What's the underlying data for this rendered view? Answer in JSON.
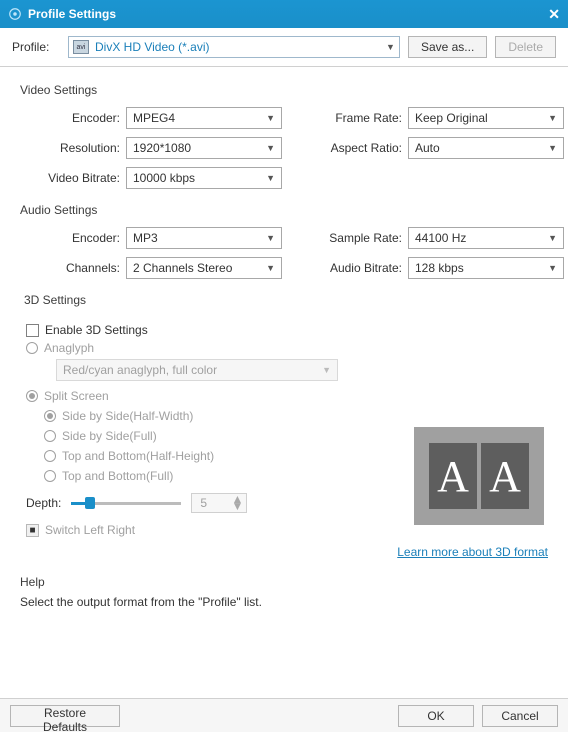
{
  "title": "Profile Settings",
  "profile": {
    "label": "Profile:",
    "iconText": "avi",
    "value": "DivX HD Video (*.avi)",
    "saveAs": "Save as...",
    "delete": "Delete"
  },
  "videoSettings": {
    "title": "Video Settings",
    "encoder": {
      "label": "Encoder:",
      "value": "MPEG4"
    },
    "resolution": {
      "label": "Resolution:",
      "value": "1920*1080"
    },
    "videoBitrate": {
      "label": "Video Bitrate:",
      "value": "10000 kbps"
    },
    "frameRate": {
      "label": "Frame Rate:",
      "value": "Keep Original"
    },
    "aspectRatio": {
      "label": "Aspect Ratio:",
      "value": "Auto"
    }
  },
  "audioSettings": {
    "title": "Audio Settings",
    "encoder": {
      "label": "Encoder:",
      "value": "MP3"
    },
    "channels": {
      "label": "Channels:",
      "value": "2 Channels Stereo"
    },
    "sampleRate": {
      "label": "Sample Rate:",
      "value": "44100 Hz"
    },
    "audioBitrate": {
      "label": "Audio Bitrate:",
      "value": "128 kbps"
    }
  },
  "threeD": {
    "title": "3D Settings",
    "enable": "Enable 3D Settings",
    "anaglyph": "Anaglyph",
    "anaglyphMode": "Red/cyan anaglyph, full color",
    "splitScreen": "Split Screen",
    "sbsHalf": "Side by Side(Half-Width)",
    "sbsFull": "Side by Side(Full)",
    "tbHalf": "Top and Bottom(Half-Height)",
    "tbFull": "Top and Bottom(Full)",
    "depthLabel": "Depth:",
    "depthValue": "5",
    "switchLR": "Switch Left Right",
    "learnMore": "Learn more about 3D format",
    "previewGlyph": "A"
  },
  "help": {
    "title": "Help",
    "text": "Select the output format from the \"Profile\" list."
  },
  "footer": {
    "restore": "Restore Defaults",
    "ok": "OK",
    "cancel": "Cancel"
  }
}
